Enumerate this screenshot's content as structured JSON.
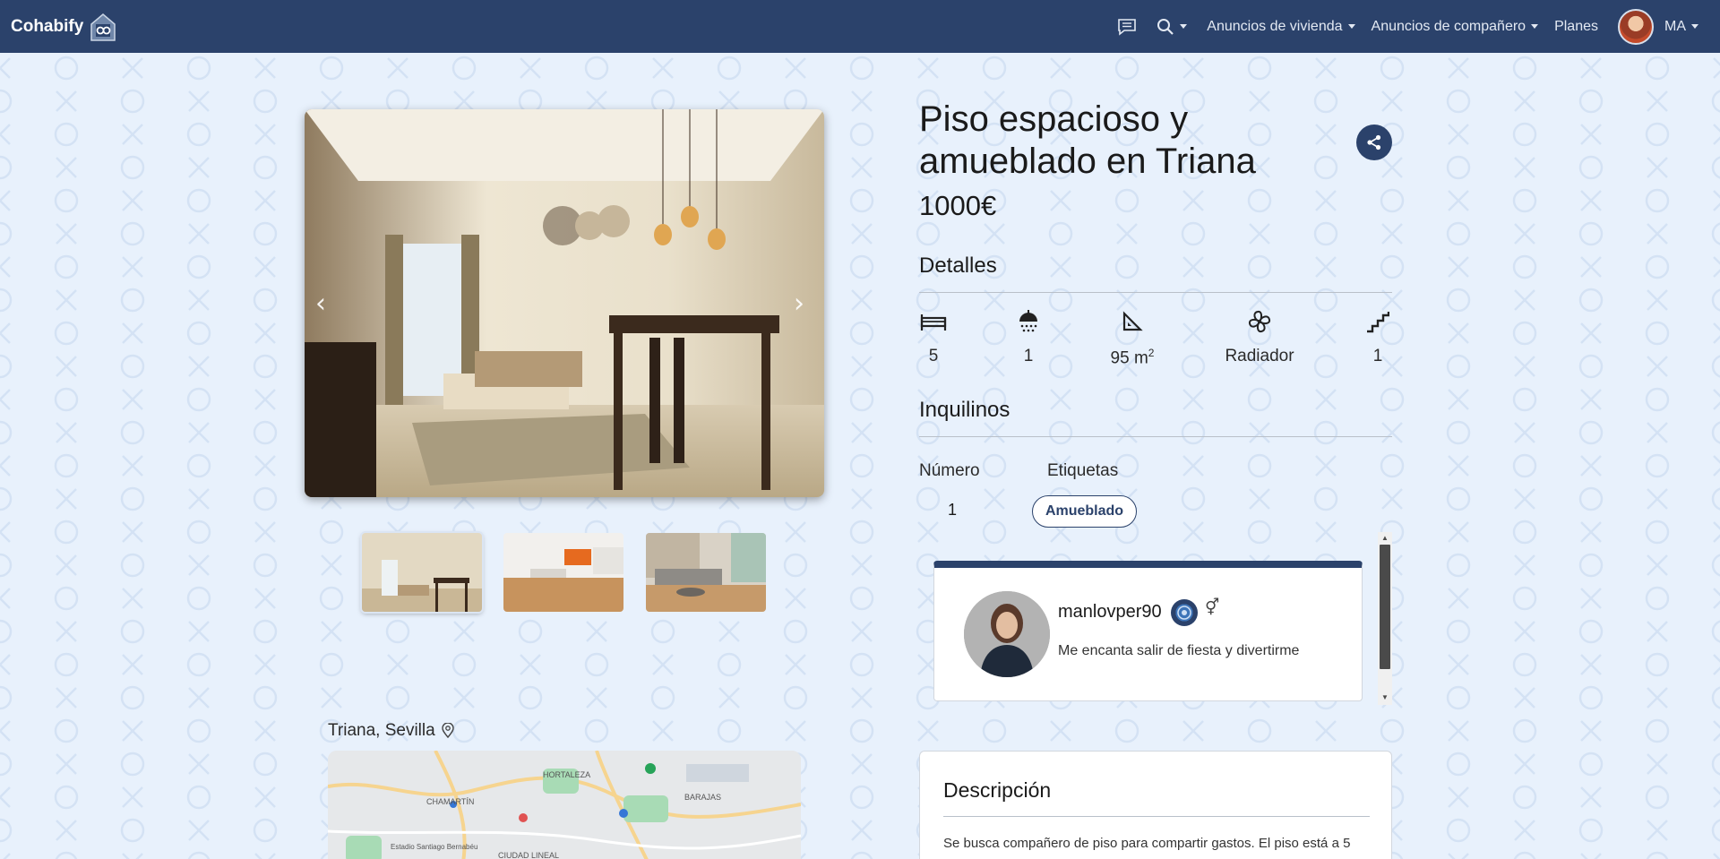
{
  "navbar": {
    "brand": "Cohabify",
    "user_initials": "MA",
    "menu": {
      "housing": "Anuncios de vivienda",
      "roommates": "Anuncios de compañero",
      "plans": "Planes"
    },
    "icons": {
      "messages": "chat-icon",
      "search": "search-icon"
    }
  },
  "listing": {
    "title": "Piso espacioso y amueblado en Triana",
    "price": "1000€",
    "details_heading": "Detalles",
    "features": [
      {
        "icon": "bed-icon",
        "value": "5"
      },
      {
        "icon": "shower-icon",
        "value": "1"
      },
      {
        "icon": "area-icon",
        "value": "95 m",
        "sup": "2"
      },
      {
        "icon": "heating-fan-icon",
        "value": "Radiador"
      },
      {
        "icon": "stairs-icon",
        "value": "1"
      }
    ],
    "tenants_heading": "Inquilinos",
    "tenants": {
      "number_label": "Número",
      "tags_label": "Etiquetas",
      "number": "1",
      "tags": [
        "Amueblado"
      ]
    },
    "location": "Triana, Sevilla",
    "description_heading": "Descripción",
    "description_text": "Se busca compañero de piso para compartir gastos. El piso está a 5"
  },
  "roommate": {
    "username": "manlovper90",
    "bio": "Me encanta salir de fiesta y divertirme",
    "gender_symbol": "⚥"
  },
  "map_labels": [
    "HORTALEZA",
    "CHAMARTÍN",
    "BARAJAS",
    "Estadio Santiago Bernabéu",
    "CIUDAD LINEAL"
  ],
  "colors": {
    "navbar": "#2b426b",
    "background": "#e8f1fc",
    "accent": "#2b426b"
  }
}
